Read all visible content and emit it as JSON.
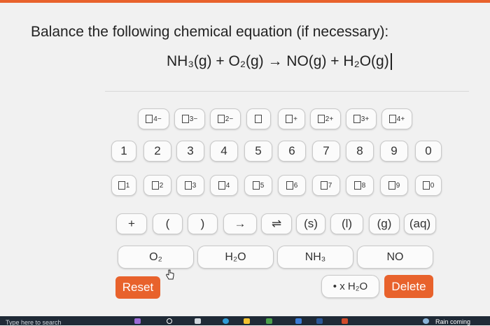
{
  "question": {
    "prompt": "Balance the following chemical equation (if necessary):",
    "equation": "NH₃(g) + O₂(g) → NO(g) + H₂O(g)"
  },
  "keypad": {
    "charges": [
      "4−",
      "3−",
      "2−",
      "",
      "+",
      "2+",
      "3+",
      "4+"
    ],
    "digits": [
      "1",
      "2",
      "3",
      "4",
      "5",
      "6",
      "7",
      "8",
      "9",
      "0"
    ],
    "subscripts": [
      "1",
      "2",
      "3",
      "4",
      "5",
      "6",
      "7",
      "8",
      "9",
      "0"
    ],
    "symbols": [
      "+",
      "(",
      ")",
      "→",
      "⇌",
      "(s)",
      "(l)",
      "(g)",
      "(aq)"
    ],
    "species": [
      "O₂",
      "H₂O",
      "NH₃",
      "NO"
    ],
    "reset_label": "Reset",
    "hydrate_label": "• x H₂O",
    "delete_label": "Delete"
  },
  "taskbar": {
    "search_placeholder": "Type here to search",
    "weather": "Rain coming"
  },
  "colors": {
    "accent": "#e8622c",
    "taskbar": "#1f2a36",
    "background": "#f1f1f1"
  }
}
